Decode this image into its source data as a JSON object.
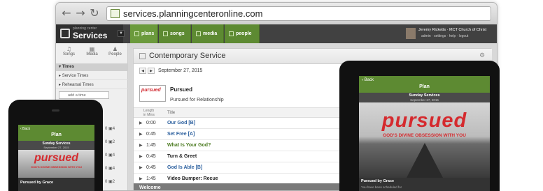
{
  "browser": {
    "url": "services.planningcenteronline.com",
    "nav": {
      "back": "←",
      "forward": "→",
      "reload": "↻"
    }
  },
  "app": {
    "brand_small": "planning center",
    "brand_name": "Services",
    "tabs": [
      {
        "label": "plans",
        "icon": "plans-icon"
      },
      {
        "label": "songs",
        "icon": "music-note-icon"
      },
      {
        "label": "media",
        "icon": "film-icon"
      },
      {
        "label": "people",
        "icon": "people-icon"
      }
    ],
    "user_name": "Jeremy Ricketts",
    "org_name": "MCT Church of Christ",
    "user_links": [
      "admin",
      "settings",
      "help",
      "logout"
    ]
  },
  "sidebar": {
    "icons": [
      {
        "label": "Songs",
        "glyph": "♫"
      },
      {
        "label": "Media",
        "glyph": "▦"
      },
      {
        "label": "People",
        "glyph": "♟"
      }
    ],
    "section": "Times",
    "rows": [
      "Service Times",
      "Rehearsal Times"
    ],
    "add_time": "add a time"
  },
  "plan": {
    "service_name": "Contemporary Service",
    "date": "September 27, 2015",
    "image_text": "pursued",
    "title": "Pursued",
    "subtitle": "Pursued for Relationship",
    "col_length": "Length",
    "col_length2": "in Mins",
    "col_title": "Title",
    "items": [
      {
        "time": "0:00",
        "title": "Our God [B]",
        "color": "#2b5f9e"
      },
      {
        "time": "0:45",
        "title": "Set Free [A]",
        "color": "#2b5f9e"
      },
      {
        "time": "1:45",
        "title": "What Is Your God?",
        "color": "#4a7a1f"
      },
      {
        "time": "0:45",
        "title": "Turn & Greet",
        "color": "#222222"
      },
      {
        "time": "0:45",
        "title": "God Is Able [B]",
        "color": "#2b5f9e"
      },
      {
        "time": "1:45",
        "title": "Video Bumper: Recue",
        "color": "#222222"
      }
    ],
    "section_header": "Welcome"
  },
  "tablet": {
    "back": "‹ Back",
    "title": "Plan",
    "service": "Sunday Services",
    "date": "September 27, 2015",
    "hero": "pursued",
    "hero_sub": "GOD'S DIVINE OBSESSION WITH YOU",
    "foot_title": "Pursued by Grace",
    "foot_sub": "You have been scheduled for"
  },
  "phone": {
    "back": "‹ Back",
    "title": "Plan",
    "service": "Sunday Services",
    "date": "September 27, 2015",
    "hero": "pursued",
    "hero_sub": "GOD'S DIVINE OBSESSION WITH YOU",
    "foot_title": "Pursued by Grace"
  },
  "counts": [
    {
      "a": "0",
      "b": "4"
    },
    {
      "a": "0",
      "b": "2"
    },
    {
      "a": "0",
      "b": "4"
    },
    {
      "a": "0",
      "b": "4"
    },
    {
      "a": "0",
      "b": "2"
    }
  ],
  "colors": {
    "accent": "#6b9a3c",
    "brand_red": "#d52a2e"
  }
}
